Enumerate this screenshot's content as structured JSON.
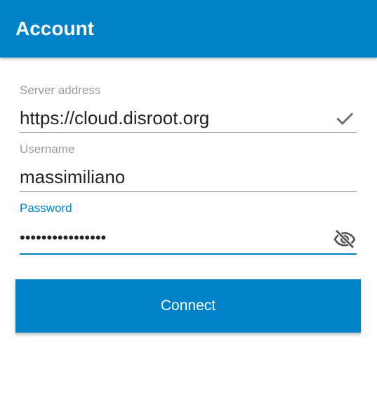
{
  "appbar": {
    "title": "Account",
    "color": "#0082c9"
  },
  "form": {
    "server": {
      "label": "Server address",
      "value": "https://cloud.disroot.org",
      "status_icon": "check-icon"
    },
    "username": {
      "label": "Username",
      "value": "massimiliano"
    },
    "password": {
      "label": "Password",
      "masked_value": "••••••••••••••••",
      "toggle_icon": "visibility-off-icon",
      "focused": true
    }
  },
  "connect": {
    "label": "Connect"
  },
  "colors": {
    "accent": "#0082c9",
    "label_gray": "#9b9b9b",
    "text": "#222222"
  }
}
